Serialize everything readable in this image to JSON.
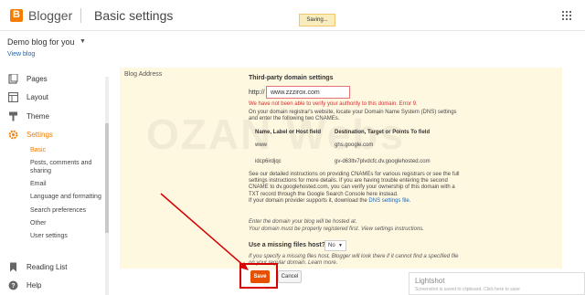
{
  "topbar": {
    "brand": "Blogger",
    "page_title": "Basic settings",
    "saving_text": "Saving..."
  },
  "blog": {
    "name": "Demo blog for you",
    "view_blog": "View blog"
  },
  "sidebar": {
    "items": [
      {
        "label": "Pages",
        "icon": "pages-icon"
      },
      {
        "label": "Layout",
        "icon": "layout-icon"
      },
      {
        "label": "Theme",
        "icon": "theme-icon"
      },
      {
        "label": "Settings",
        "icon": "gear-icon"
      }
    ],
    "subitems": [
      "Basic",
      "Posts, comments and sharing",
      "Email",
      "Language and formatting",
      "Search preferences",
      "Other",
      "User settings"
    ],
    "bottom_items": [
      {
        "label": "Reading List",
        "icon": "bookmark-icon"
      },
      {
        "label": "Help",
        "icon": "help-icon"
      }
    ]
  },
  "main": {
    "section_label": "Blog Address",
    "third_party_title": "Third-party domain settings",
    "http_label": "http://",
    "domain_value": "www.zzzirox.com",
    "error_text": "We have not been able to verify your authority to this domain. Error 9.",
    "info_text": "On your domain registrar's website, locate your Domain Name System (DNS) settings and enter the following two CNAMEs.",
    "dns_table": {
      "headers": [
        "Name, Label or Host field",
        "Destination, Target or Points To field"
      ],
      "rows": [
        [
          "www",
          "ghs.google.com"
        ],
        [
          "idcp6irdjqc",
          "gv-d63ltv7plvdcfc.dv.googlehosted.com"
        ]
      ]
    },
    "instructions_text": "See our detailed instructions on providing CNAMEs for various registrars or see the full settings instructions for more details. If you are having trouble entering the second CNAME to dv.googlehosted.com, you can verify your ownership of this domain with a TXT record through the Google Search Console here instead.",
    "provider_text_pre": "If your domain provider supports it, download the ",
    "provider_link": "DNS settings file.",
    "hosted_note_1": "Enter the domain your blog will be hosted at.",
    "hosted_note_2": "Your domain must be properly registered first. View settings instructions.",
    "missing_files_label": "Use a missing files host?",
    "missing_files_value": "No",
    "missing_files_note": "If you specify a missing files host, Blogger will look there if it cannot find a specified file on your regular domain. Learn more.",
    "save_label": "Save",
    "cancel_label": "Cancel"
  },
  "lightshot": {
    "title": "Lightshot",
    "text": "Screenshot is saved to clipboard. Click here to save"
  },
  "watermark": "OZAN Webs",
  "colors": {
    "accent": "#f57d00",
    "error": "#d32f2f",
    "panel": "#fff8e1",
    "highlight": "#d50000"
  }
}
